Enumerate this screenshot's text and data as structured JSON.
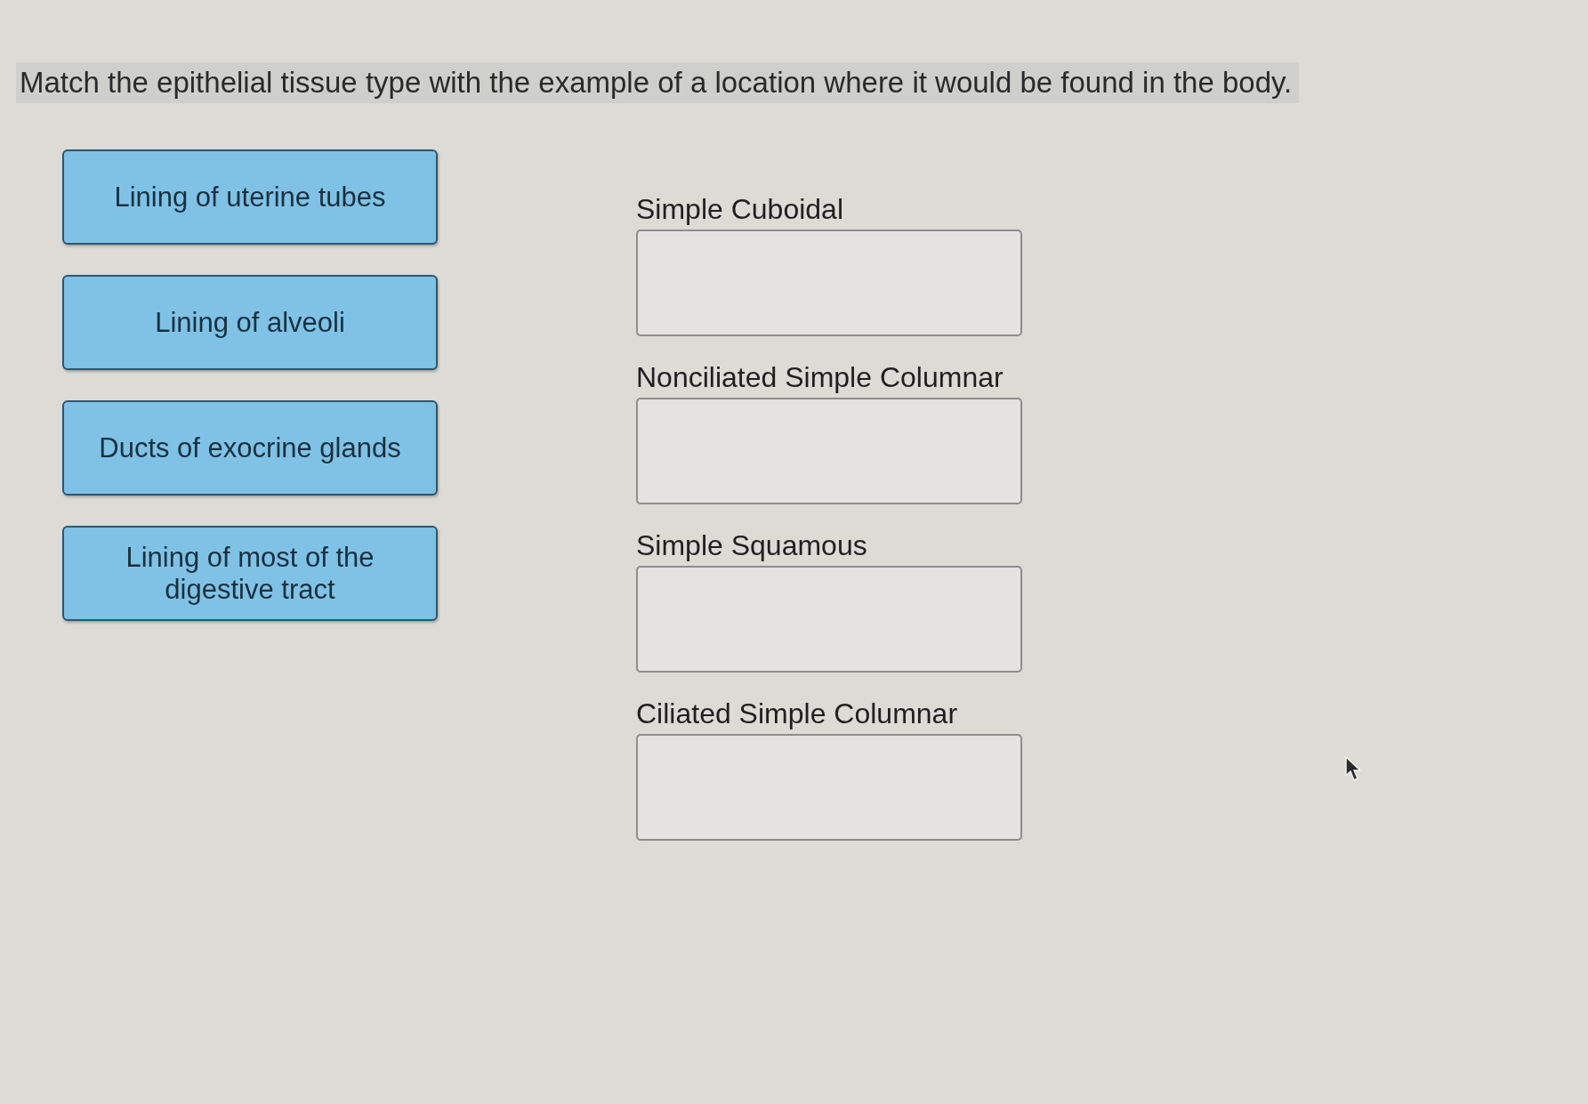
{
  "instruction": "Match the epithelial tissue type with the example of a location where it would be found in the body.",
  "choices": [
    {
      "label": "Lining of uterine tubes"
    },
    {
      "label": "Lining of alveoli"
    },
    {
      "label": "Ducts of exocrine glands"
    },
    {
      "label": "Lining of most of the digestive tract"
    }
  ],
  "targets": [
    {
      "label": "Simple Cuboidal"
    },
    {
      "label": "Nonciliated Simple Columnar"
    },
    {
      "label": "Simple Squamous"
    },
    {
      "label": "Ciliated Simple Columnar"
    }
  ]
}
